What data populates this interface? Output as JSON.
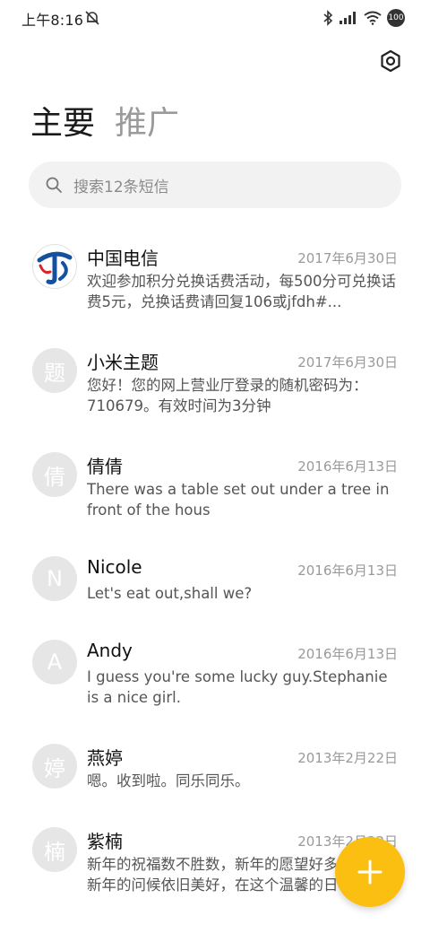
{
  "status_bar": {
    "time": "上午8:16",
    "battery": "100",
    "icons": [
      "do-not-disturb-icon",
      "bluetooth-icon",
      "signal-icon",
      "wifi-icon",
      "battery-icon"
    ]
  },
  "header": {
    "settings_icon": "settings-icon"
  },
  "tabs": [
    {
      "label": "主要",
      "active": true
    },
    {
      "label": "推广",
      "active": false
    }
  ],
  "search": {
    "placeholder": "搜索12条短信"
  },
  "conversations": [
    {
      "name": "中国电信",
      "date": "2017年6月30日",
      "preview": "欢迎参加积分兑换话费活动，每500分可兑换话费5元，兑换话费请回复106或jfdh#...",
      "avatar": ""
    },
    {
      "name": "小米主题",
      "date": "2017年6月30日",
      "preview": "您好！您的网上营业厅登录的随机密码为：710679。有效时间为3分钟",
      "avatar": "题"
    },
    {
      "name": "倩倩",
      "date": "2016年6月13日",
      "preview": "There was a table set out under a tree in front of the hous",
      "avatar": "倩"
    },
    {
      "name": "Nicole",
      "date": "2016年6月13日",
      "preview": "Let's eat out,shall we?",
      "avatar": "N"
    },
    {
      "name": "Andy",
      "date": "2016年6月13日",
      "preview": "I guess you're some lucky guy.Stephanie is a nice girl.",
      "avatar": "A"
    },
    {
      "name": "燕婷",
      "date": "2013年2月22日",
      "preview": "嗯。收到啦。同乐同乐。",
      "avatar": "婷"
    },
    {
      "name": "紫楠",
      "date": "2013年2月22日",
      "preview": "新年的祝福数不胜数，新年的愿望好多好多，新年的问候依旧美好，在这个温馨的日子",
      "avatar": "楠"
    }
  ],
  "fab": {
    "icon": "plus-icon",
    "color": "#fbbf12"
  },
  "colors": {
    "accent": "#fbbf12",
    "telecom_blue": "#1450a0"
  }
}
